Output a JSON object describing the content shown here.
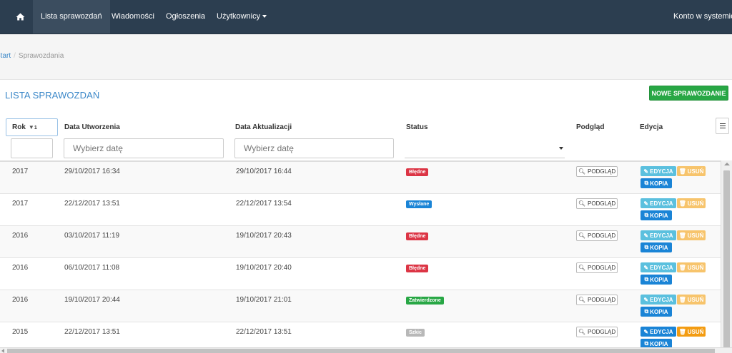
{
  "nav": {
    "items": [
      "Lista sprawozdań",
      "Wiadomości",
      "Ogłoszenia",
      "Użytkownicy"
    ],
    "account": "Konto w systemie"
  },
  "breadcrumb": {
    "start": "Start",
    "current": "Sprawozdania"
  },
  "page": {
    "title": "LISTA SPRAWOZDAŃ",
    "new_button": "NOWE SPRAWOZDANIE"
  },
  "table": {
    "headers": {
      "rok": "Rok",
      "sort_order": "1",
      "created": "Data Utworzenia",
      "updated": "Data Aktualizacji",
      "status": "Status",
      "preview": "Podgląd",
      "edit": "Edycja"
    },
    "filters": {
      "created_placeholder": "Wybierz datę",
      "updated_placeholder": "Wybierz datę"
    },
    "buttons": {
      "preview": "PODGLĄD",
      "edit": "EDYCJA",
      "delete": "USUŃ",
      "copy": "KOPIA"
    },
    "rows": [
      {
        "year": "2017",
        "created": "29/10/2017 16:34",
        "updated": "29/10/2017 16:44",
        "status": "Błędne"
      },
      {
        "year": "2017",
        "created": "22/12/2017 13:51",
        "updated": "22/12/2017 13:54",
        "status": "Wysłane"
      },
      {
        "year": "2016",
        "created": "03/10/2017 11:19",
        "updated": "19/10/2017 20:43",
        "status": "Błędne"
      },
      {
        "year": "2016",
        "created": "06/10/2017 11:08",
        "updated": "19/10/2017 20:40",
        "status": "Błędne"
      },
      {
        "year": "2016",
        "created": "19/10/2017 20:44",
        "updated": "19/10/2017 21:01",
        "status": "Zatwierdzone"
      },
      {
        "year": "2015",
        "created": "22/12/2017 13:51",
        "updated": "22/12/2017 13:51",
        "status": "Szkic"
      }
    ]
  },
  "colors": {
    "navbar": "#2c3e50",
    "accent": "#3a87c8",
    "new_button": "#28a745",
    "status_bledne": "#dc3545",
    "status_wyslane": "#1a84d6",
    "status_zatwierdzone": "#28a745",
    "status_szkic": "#b8b8b8"
  }
}
